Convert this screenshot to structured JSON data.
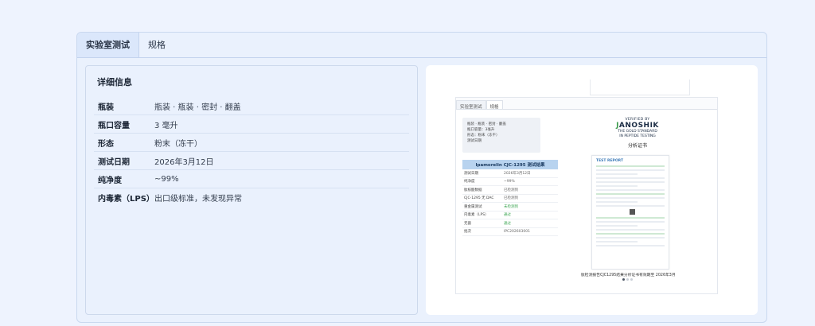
{
  "tabs": [
    {
      "label": "实验室测试",
      "active": true
    },
    {
      "label": "规格",
      "active": false
    }
  ],
  "details": {
    "title": "详细信息",
    "rows": [
      {
        "key": "瓶装",
        "value": "瓶装 · 瓶装 · 密封 · 翻盖"
      },
      {
        "key": "瓶口容量",
        "value": "3 毫升"
      },
      {
        "key": "形态",
        "value": "粉末（冻干）"
      },
      {
        "key": "测试日期",
        "value": "2026年3月12日"
      },
      {
        "key": "纯净度",
        "value": "~99%"
      },
      {
        "key": "内毒素（LPS）",
        "value": "出口级标准，未发现异常"
      }
    ]
  },
  "preview": {
    "mini_tabs": [
      "实验室测试",
      "规格"
    ],
    "info_lines": [
      "瓶装 · 瓶装 · 密封 · 翻盖",
      "瓶口容量：3毫升",
      "形态：粉末（冻干）",
      "测试日期"
    ],
    "results_title": "Ipamorelin CJC-1295 测试结果",
    "results_rows": [
      {
        "k": "测试日期",
        "v": "2026年3月12日",
        "green": false
      },
      {
        "k": "纯净度",
        "v": "~99%",
        "green": false
      },
      {
        "k": "肽核酸数据",
        "v": "已检测到",
        "green": false
      },
      {
        "k": "CJC-1295 无 DAC",
        "v": "已检测到",
        "green": false
      },
      {
        "k": "重金属测试",
        "v": "未检测到",
        "green": true
      },
      {
        "k": "内毒素（LPS）",
        "v": "通过",
        "green": true
      },
      {
        "k": "无菌",
        "v": "通过",
        "green": true
      },
      {
        "k": "批次",
        "v": "IPC202603001",
        "green": false
      }
    ],
    "verified_by": "VERIFIED BY",
    "logo_prefix": "J",
    "logo_rest": "ANOSHIK",
    "tagline_1": "THE GOLD STANDARD",
    "tagline_2": "IN PEPTIDE TESTING",
    "certificate_label": "分析证书",
    "report_title": "TEST REPORT",
    "caption": "肽检测报告CJC1295结果分析证书有效期至 2026年3月",
    "page_dots": 3,
    "active_dot": 0
  }
}
